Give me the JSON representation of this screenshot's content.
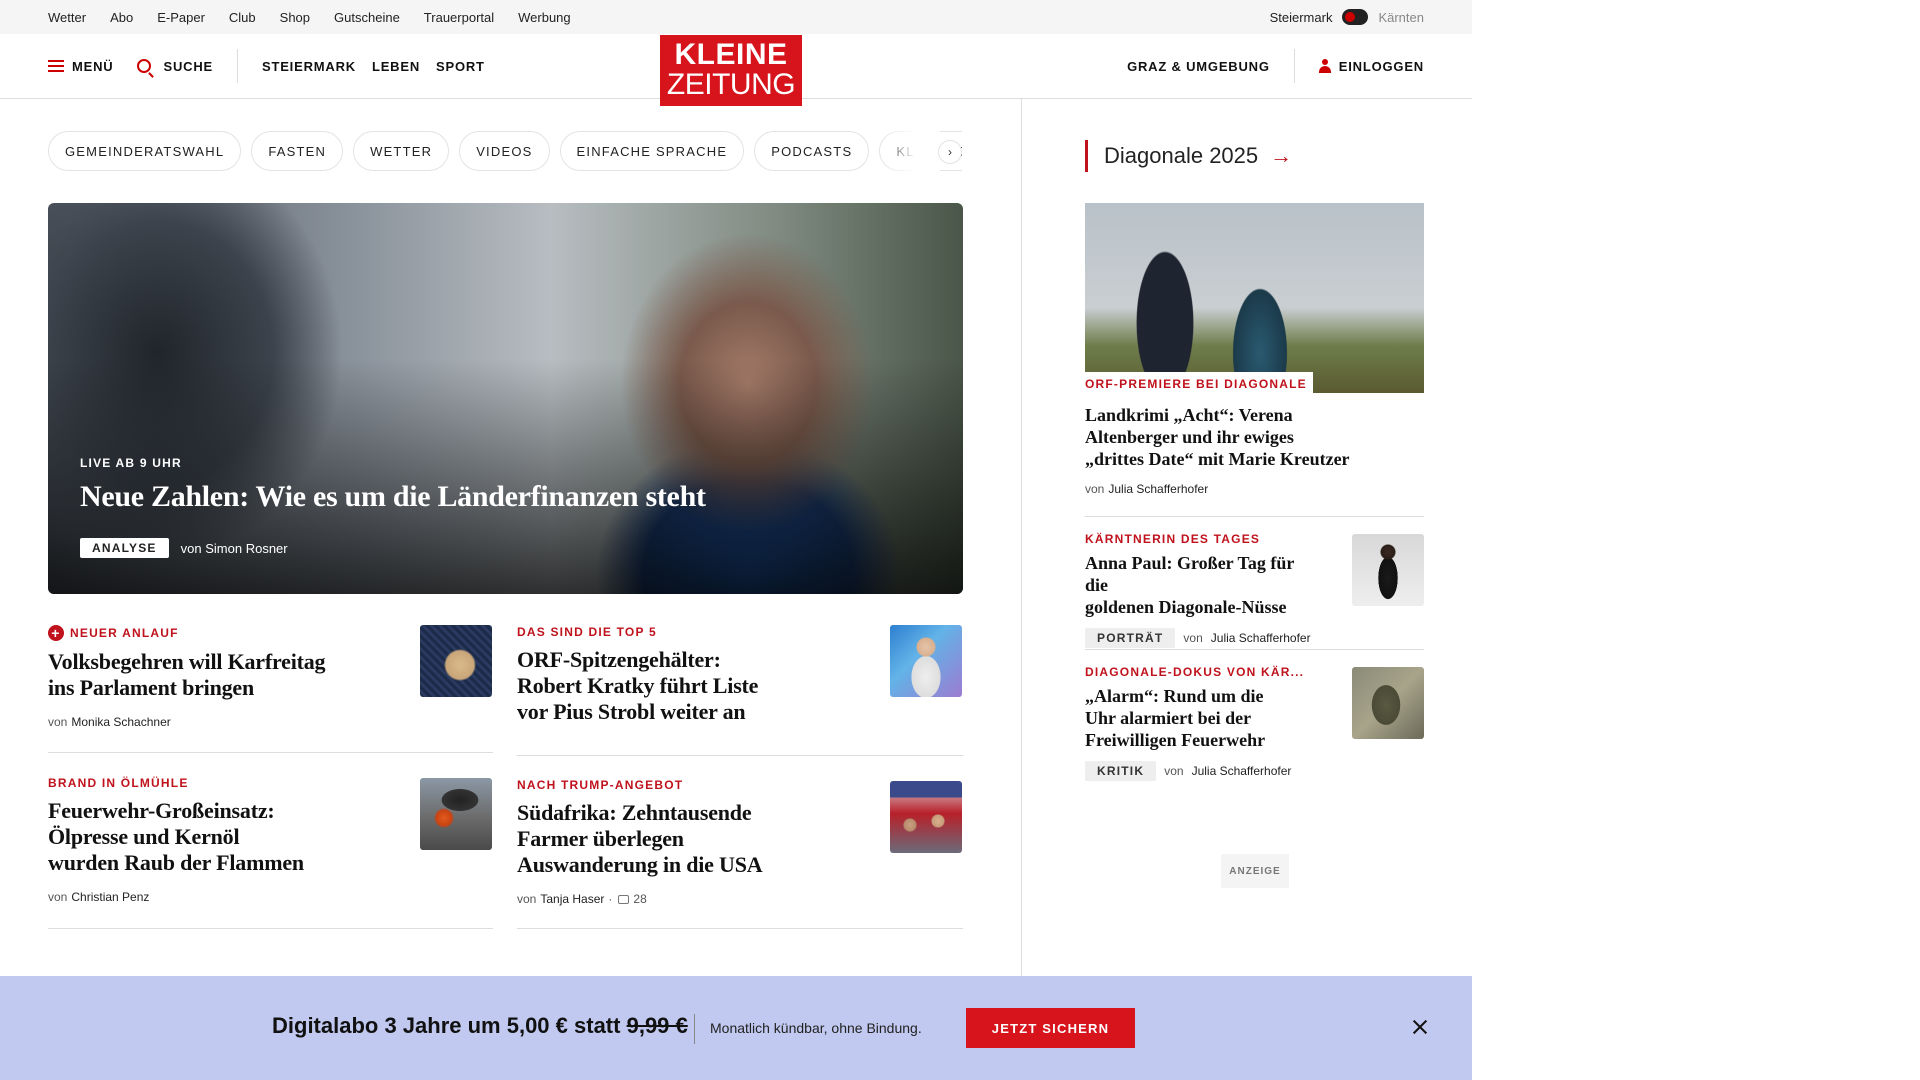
{
  "utility_bar": {
    "links": [
      "Wetter",
      "Abo",
      "E-Paper",
      "Club",
      "Shop",
      "Gutscheine",
      "Trauerportal",
      "Werbung"
    ],
    "region_active": "Steiermark",
    "region_inactive": "Kärnten"
  },
  "nav": {
    "menu_label": "MENÜ",
    "search_label": "SUCHE",
    "sections": [
      "STEIERMARK",
      "LEBEN",
      "SPORT"
    ],
    "logo_line1": "KLEINE",
    "logo_line2": "ZEITUNG",
    "local_label": "GRAZ & UMGEBUNG",
    "login_label": "EINLOGGEN"
  },
  "chips": [
    "GEMEINDERATSWAHL",
    "FASTEN",
    "WETTER",
    "VIDEOS",
    "EINFACHE SPRACHE",
    "PODCASTS",
    "KLEINE KINDER"
  ],
  "hero": {
    "kicker": "LIVE AB 9 UHR",
    "title": "Neue Zahlen: Wie es um die Länderfinanzen steht",
    "badge": "ANALYSE",
    "by": "von",
    "author": "Simon Rosner"
  },
  "teasers": [
    {
      "kicker": "NEUER ANLAUF",
      "title_1": "Volksbegehren will Karfreitag",
      "title_2": "ins Parlament bringen",
      "title_3": "",
      "by": "von",
      "author": "Monika Schachner"
    },
    {
      "kicker": "DAS SIND DIE TOP 5",
      "title_1": "ORF-Spitzengehälter:",
      "title_2": "Robert Kratky führt Liste",
      "title_3": "vor Pius Strobl weiter an",
      "by": "",
      "author": ""
    },
    {
      "kicker": "BRAND IN ÖLMÜHLE",
      "title_1": "Feuerwehr-Großeinsatz:",
      "title_2": "Ölpresse und Kernöl",
      "title_3": "wurden Raub der Flammen",
      "by": "von",
      "author": "Christian Penz"
    },
    {
      "kicker": "NACH TRUMP-ANGEBOT",
      "title_1": "Südafrika: Zehntausende",
      "title_2": "Farmer überlegen",
      "title_3": "Auswanderung in die USA",
      "by": "von",
      "author": "Tanja Haser",
      "comments": "28"
    }
  ],
  "sidebar": {
    "heading": "Diagonale 2025",
    "lead": {
      "kicker": "ORF-PREMIERE BEI DIAGONALE",
      "title_1": "Landkrimi „Acht“: Verena",
      "title_2": "Altenberger und ihr ewiges",
      "title_3": "„drittes Date“ mit Marie Kreutzer",
      "by": "von",
      "author": "Julia Schafferhofer"
    },
    "items": [
      {
        "kicker": "KÄRNTNERIN DES TAGES",
        "title_1": "Anna Paul: Großer Tag für die",
        "title_2": "goldenen Diagonale-Nüsse",
        "title_3": "",
        "badge": "PORTRÄT",
        "by": "von",
        "author": "Julia Schafferhofer"
      },
      {
        "kicker": "DIAGONALE-DOKUS VON KÄR...",
        "title_1": "„Alarm“: Rund um die",
        "title_2": "Uhr alarmiert bei der",
        "title_3": "Freiwilligen Feuerwehr",
        "badge": "KRITIK",
        "by": "von",
        "author": "Julia Schafferhofer"
      }
    ],
    "ad_label": "ANZEIGE"
  },
  "promo": {
    "text": "Digitalabo 3 Jahre um 5,00 € statt",
    "old_price": "9,99 €",
    "subtext": "Monatlich kündbar, ohne Bindung.",
    "button": "JETZT SICHERN"
  },
  "colors": {
    "brand_red": "#d7131c",
    "kicker_red": "#c0121c",
    "promo_bg": "#c1c9f0"
  }
}
